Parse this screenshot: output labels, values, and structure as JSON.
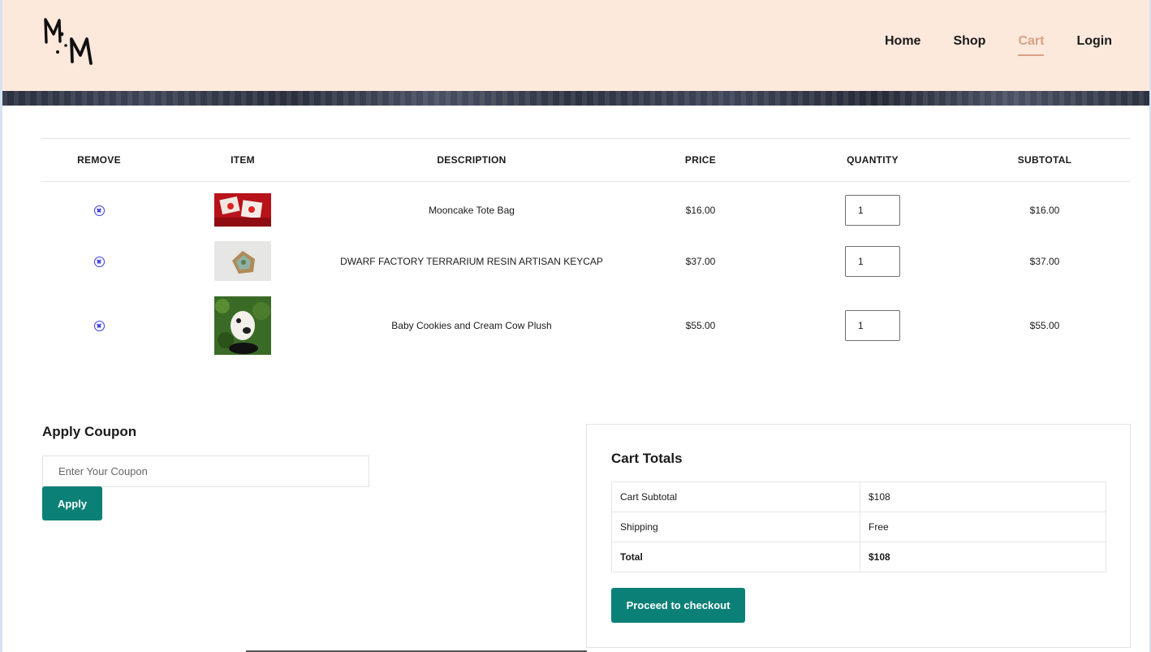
{
  "brand": {
    "logo_text": "M·M"
  },
  "nav": {
    "items": [
      {
        "label": "Home",
        "active": false
      },
      {
        "label": "Shop",
        "active": false
      },
      {
        "label": "Cart",
        "active": true
      },
      {
        "label": "Login",
        "active": false
      }
    ],
    "active_color": "#d9a085"
  },
  "cart": {
    "headers": [
      "REMOVE",
      "ITEM",
      "DESCRIPTION",
      "PRICE",
      "QUANTITY",
      "SUBTOTAL"
    ],
    "rows": [
      {
        "description": "Mooncake Tote Bag",
        "price": "$16.00",
        "quantity": "1",
        "subtotal": "$16.00"
      },
      {
        "description": "DWARF FACTORY TERRARIUM RESIN ARTISAN KEYCAP",
        "price": "$37.00",
        "quantity": "1",
        "subtotal": "$37.00"
      },
      {
        "description": "Baby Cookies and Cream Cow Plush",
        "price": "$55.00",
        "quantity": "1",
        "subtotal": "$55.00"
      }
    ]
  },
  "coupon": {
    "title": "Apply Coupon",
    "placeholder": "Enter Your Coupon",
    "apply_label": "Apply"
  },
  "totals": {
    "title": "Cart Totals",
    "rows": [
      {
        "label": "Cart Subtotal",
        "value": "$108"
      },
      {
        "label": "Shipping",
        "value": "Free"
      },
      {
        "label": "Total",
        "value": "$108"
      }
    ],
    "checkout_label": "Proceed to checkout"
  },
  "colors": {
    "header_bg": "#fde9dc",
    "button": "#0b8077",
    "remove_icon": "#3a3ae0"
  }
}
